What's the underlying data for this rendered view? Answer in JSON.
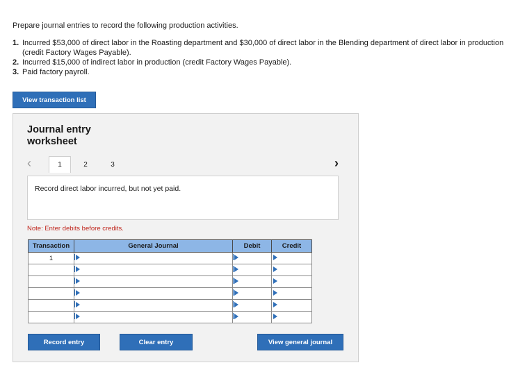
{
  "intro": {
    "prompt": "Prepare journal entries to record the following production activities.",
    "items": [
      {
        "num": "1.",
        "text": "Incurred $53,000 of direct labor in the Roasting department and $30,000 of direct labor in the Blending department of direct labor in production (credit Factory Wages Payable)."
      },
      {
        "num": "2.",
        "text": "Incurred $15,000 of indirect labor in production (credit Factory Wages Payable)."
      },
      {
        "num": "3.",
        "text": "Paid factory payroll."
      }
    ]
  },
  "buttons": {
    "view_transaction_list": "View transaction list",
    "record_entry": "Record entry",
    "clear_entry": "Clear entry",
    "view_general_journal": "View general journal"
  },
  "worksheet": {
    "title": "Journal entry worksheet",
    "pager": {
      "prev": "‹",
      "next": "›",
      "pages": [
        "1",
        "2",
        "3"
      ],
      "active": 0
    },
    "description": "Record direct labor incurred, but not yet paid.",
    "note": "Note: Enter debits before credits.",
    "table": {
      "headers": [
        "Transaction",
        "General Journal",
        "Debit",
        "Credit"
      ],
      "rows": [
        {
          "transaction": "1"
        },
        {
          "transaction": ""
        },
        {
          "transaction": ""
        },
        {
          "transaction": ""
        },
        {
          "transaction": ""
        },
        {
          "transaction": ""
        }
      ]
    }
  },
  "colors": {
    "button": "#2f6fb8",
    "header": "#8db6e6",
    "note": "#c0261d"
  }
}
